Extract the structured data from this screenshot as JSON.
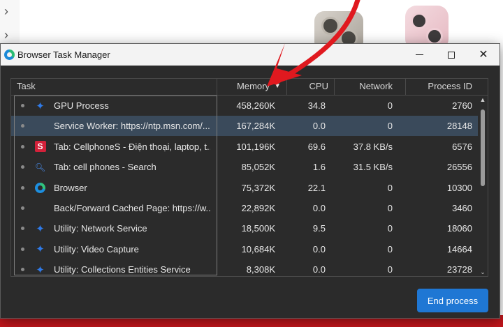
{
  "window": {
    "title": "Browser Task Manager"
  },
  "columns": {
    "task": "Task",
    "memory": "Memory",
    "cpu": "CPU",
    "network": "Network",
    "process_id": "Process ID"
  },
  "rows": [
    {
      "name": "GPU Process",
      "memory": "458,260K",
      "cpu": "34.8",
      "network": "0",
      "pid": "2760",
      "icon": "puzzle-icon",
      "selected": false
    },
    {
      "name": "Service Worker: https://ntp.msn.com/...",
      "memory": "167,284K",
      "cpu": "0.0",
      "network": "0",
      "pid": "28148",
      "icon": "none",
      "selected": true
    },
    {
      "name": "Tab: CellphoneS - Điện thoại, laptop, t...",
      "memory": "101,196K",
      "cpu": "69.6",
      "network": "37.8 KB/s",
      "pid": "6576",
      "icon": "s-logo-icon",
      "selected": false
    },
    {
      "name": "Tab: cell phones - Search",
      "memory": "85,052K",
      "cpu": "1.6",
      "network": "31.5 KB/s",
      "pid": "26556",
      "icon": "search-icon",
      "selected": false
    },
    {
      "name": "Browser",
      "memory": "75,372K",
      "cpu": "22.1",
      "network": "0",
      "pid": "10300",
      "icon": "edge-icon",
      "selected": false
    },
    {
      "name": "Back/Forward Cached Page: https://w...",
      "memory": "22,892K",
      "cpu": "0.0",
      "network": "0",
      "pid": "3460",
      "icon": "none",
      "selected": false
    },
    {
      "name": "Utility: Network Service",
      "memory": "18,500K",
      "cpu": "9.5",
      "network": "0",
      "pid": "18060",
      "icon": "puzzle-icon",
      "selected": false
    },
    {
      "name": "Utility: Video Capture",
      "memory": "10,684K",
      "cpu": "0.0",
      "network": "0",
      "pid": "14664",
      "icon": "puzzle-icon",
      "selected": false
    },
    {
      "name": "Utility: Collections Entities Service",
      "memory": "8,308K",
      "cpu": "0.0",
      "network": "0",
      "pid": "23728",
      "icon": "puzzle-icon",
      "selected": false
    }
  ],
  "buttons": {
    "end_process": "End process"
  },
  "colors": {
    "accent": "#1f77d4",
    "selection": "#3a4a5b",
    "annotation": "#e0191f"
  }
}
